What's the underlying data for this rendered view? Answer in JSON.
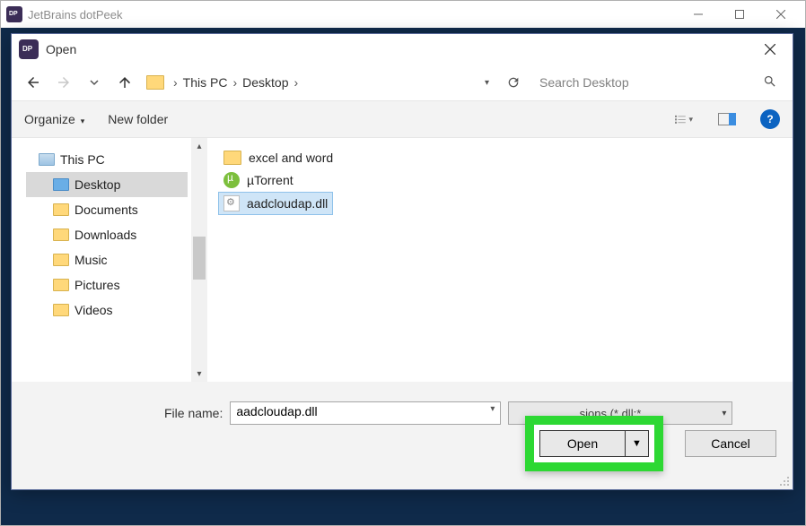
{
  "parent_window": {
    "title": "JetBrains dotPeek"
  },
  "dialog": {
    "title": "Open",
    "close": "✕"
  },
  "breadcrumb": {
    "seg1": "This PC",
    "seg2": "Desktop"
  },
  "search": {
    "placeholder": "Search Desktop"
  },
  "toolbar": {
    "organize": "Organize",
    "new_folder": "New folder"
  },
  "tree": {
    "this_pc": "This PC",
    "desktop": "Desktop",
    "documents": "Documents",
    "downloads": "Downloads",
    "music": "Music",
    "pictures": "Pictures",
    "videos": "Videos"
  },
  "files": {
    "f1": "excel and word",
    "f2": "µTorrent",
    "f3": "aadcloudap.dll"
  },
  "footer": {
    "filename_label": "File name:",
    "filename_value": "aadcloudap.dll",
    "filter_text": "sions (*.dll;*.",
    "open": "Open",
    "cancel": "Cancel"
  }
}
